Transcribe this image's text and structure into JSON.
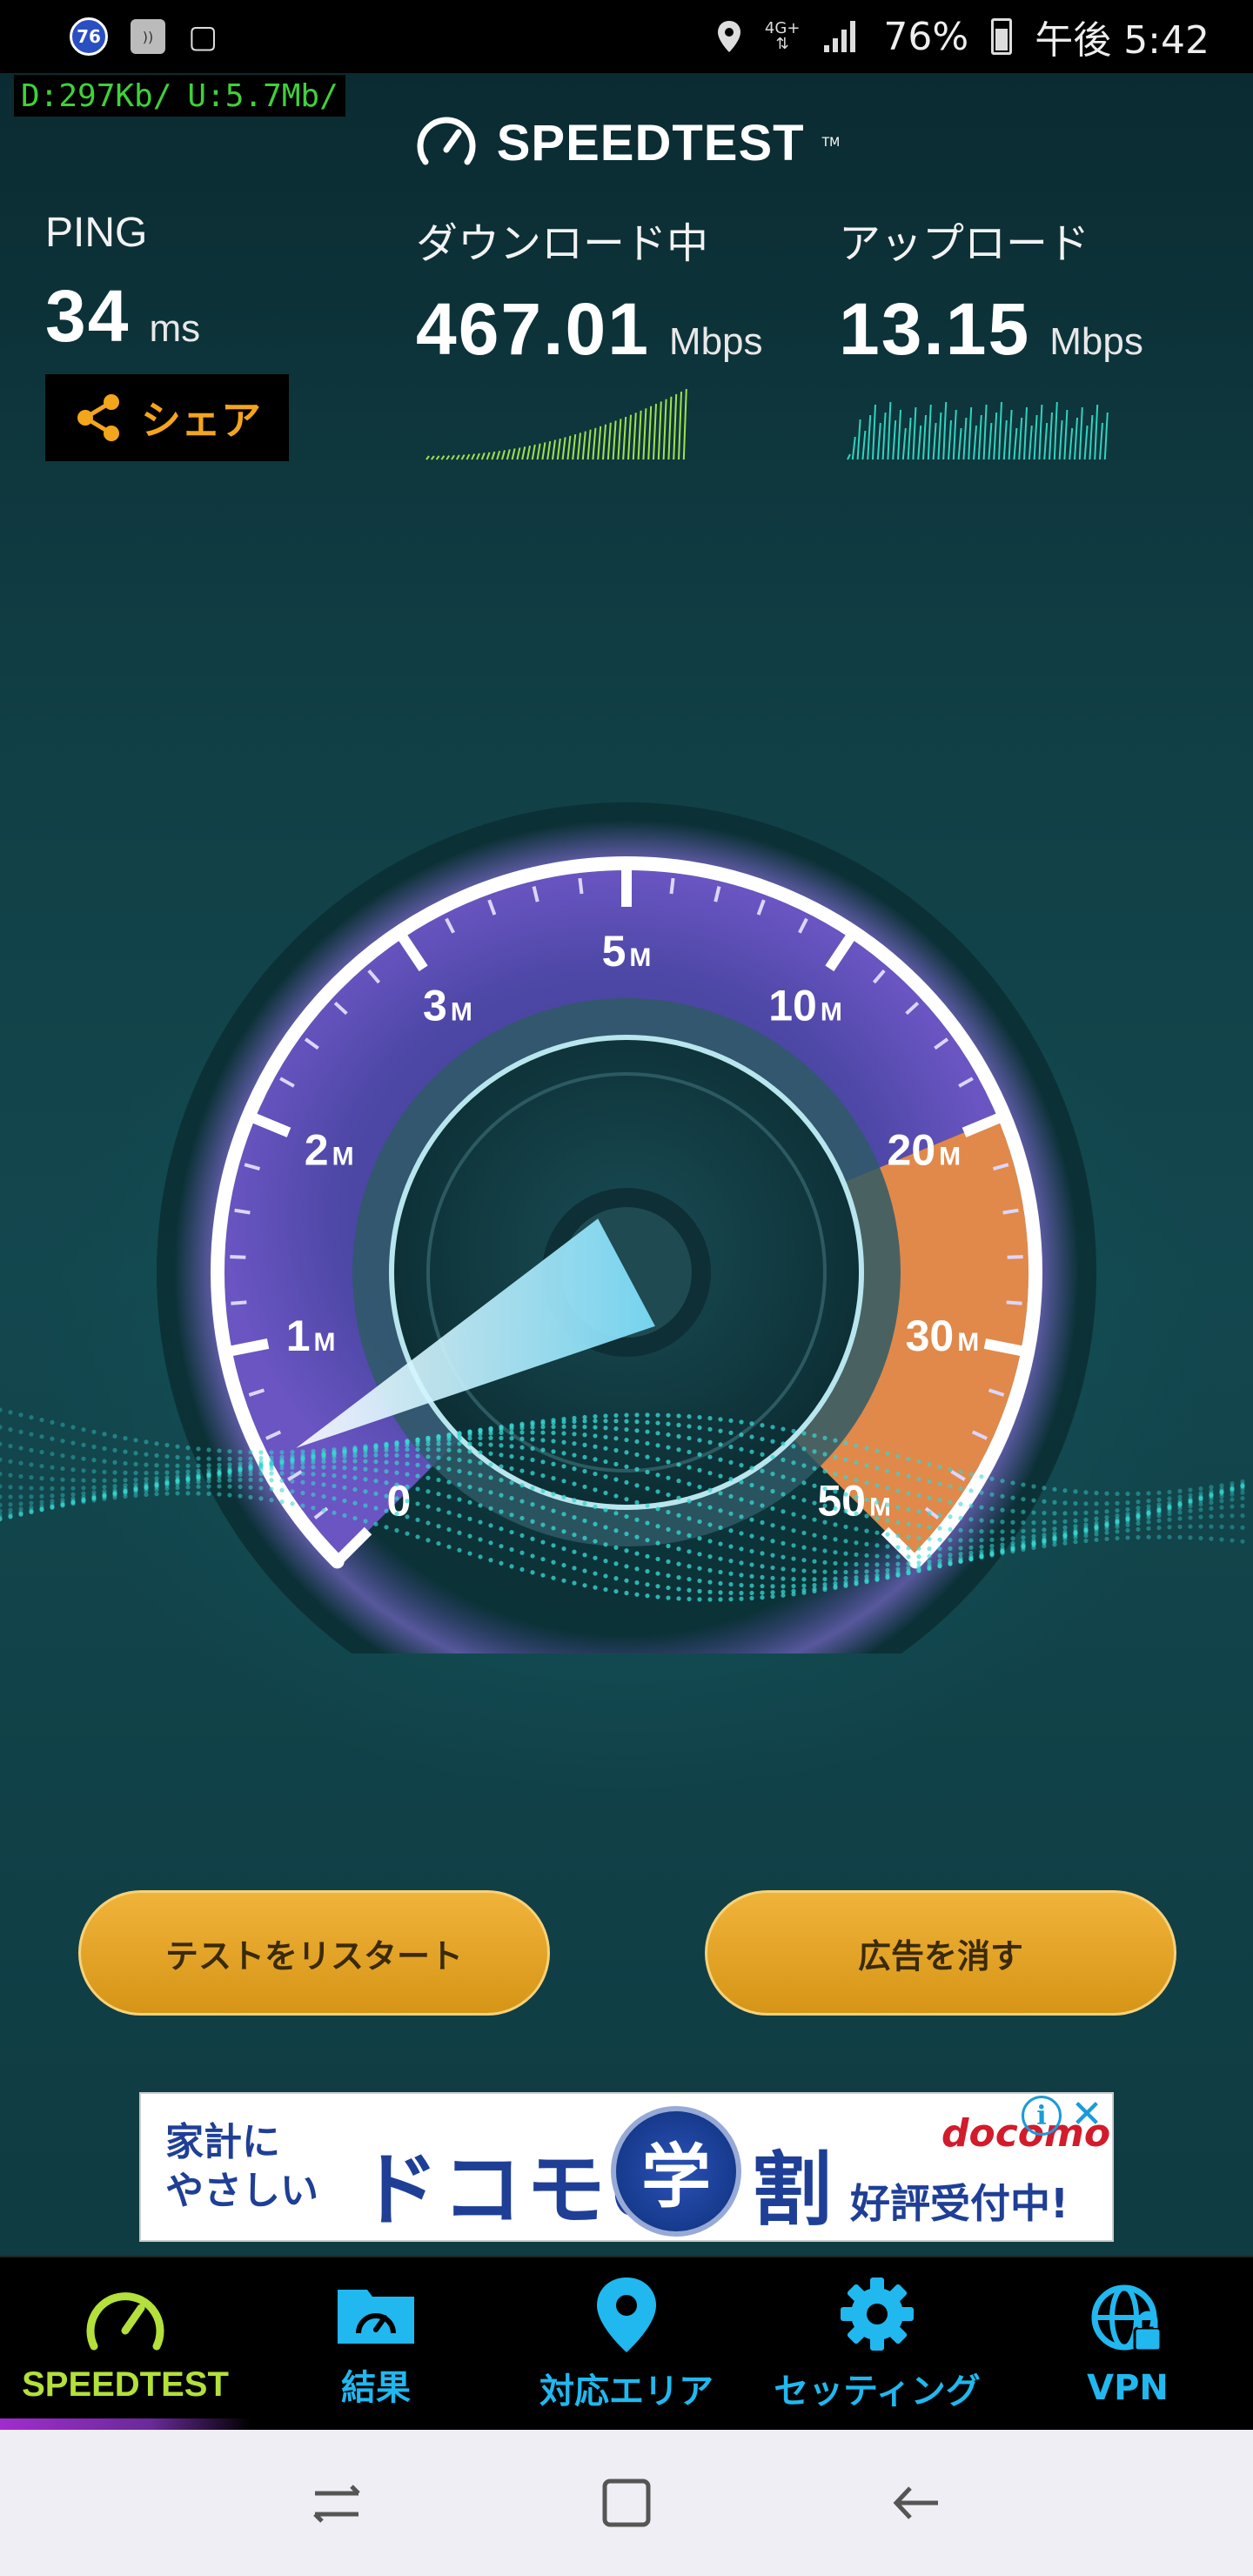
{
  "status_bar": {
    "badge": "76",
    "network": "4G+",
    "battery": "76%",
    "time": "午後 5:42"
  },
  "net_monitor": {
    "down": "D:297Kb/",
    "up": "U:5.7Mb/"
  },
  "app": {
    "logo_text": "SPEEDTEST",
    "logo_tm": "TM"
  },
  "stats": {
    "ping": {
      "label": "PING",
      "value": "34",
      "unit": "ms"
    },
    "download": {
      "label": "ダウンロード中",
      "value": "467.01",
      "unit": "Mbps"
    },
    "upload": {
      "label": "アップロード",
      "value": "13.15",
      "unit": "Mbps"
    }
  },
  "share_button": "シェア",
  "gauge": {
    "scale_labels": [
      {
        "num": "0",
        "unit": ""
      },
      {
        "num": "1",
        "unit": "M"
      },
      {
        "num": "2",
        "unit": "M"
      },
      {
        "num": "3",
        "unit": "M"
      },
      {
        "num": "5",
        "unit": "M"
      },
      {
        "num": "10",
        "unit": "M"
      },
      {
        "num": "20",
        "unit": "M"
      },
      {
        "num": "30",
        "unit": "M"
      },
      {
        "num": "50",
        "unit": "M"
      }
    ],
    "colors": {
      "arc_fill": "#5a4db0",
      "upload_fill": "#e0894a",
      "needle": "#d8f6ff"
    }
  },
  "buttons": {
    "restart": "テストをリスタート",
    "remove_ads": "広告を消す"
  },
  "ad": {
    "line1": "家計に",
    "line2": "やさしい",
    "main": "ドコモの",
    "seal": "学",
    "wari": "割",
    "brand": "docomo",
    "sub": "好評受付中!"
  },
  "nav": [
    {
      "label": "SPEEDTEST",
      "icon": "speedometer-icon",
      "active": true
    },
    {
      "label": "結果",
      "icon": "results-folder-icon",
      "active": false
    },
    {
      "label": "対応エリア",
      "icon": "map-pin-icon",
      "active": false
    },
    {
      "label": "セッティング",
      "icon": "gear-icon",
      "active": false
    },
    {
      "label": "VPN",
      "icon": "vpn-globe-icon",
      "active": false
    }
  ]
}
